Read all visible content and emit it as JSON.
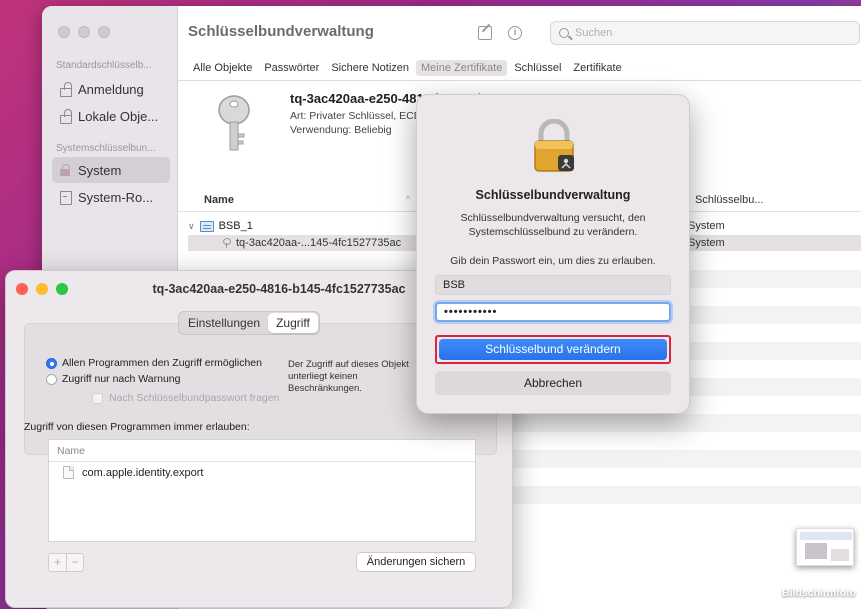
{
  "keychain": {
    "window_title": "Schlüsselbundverwaltung",
    "search_placeholder": "Suchen",
    "sidebar": {
      "section_default": "Standardschlüsselb...",
      "default_items": [
        "Anmeldung",
        "Lokale Obje..."
      ],
      "section_system": "Systemschlüsselbun...",
      "system_items": [
        "System",
        "System-Ro..."
      ],
      "selected": "System"
    },
    "tabs": [
      "Alle Objekte",
      "Passwörter",
      "Sichere Notizen",
      "Meine Zertifikate",
      "Schlüssel",
      "Zertifikate"
    ],
    "active_tab": "Meine Zertifikate",
    "detail": {
      "title": "tq-3ac420aa-e250-4816-b145-4fc1527735ac",
      "kind": "Art: Privater Schlüssel, ECDSA",
      "usage": "Verwendung: Beliebig"
    },
    "list": {
      "col_name": "Name",
      "col_keychain": "Schlüsselbu...",
      "group_name": "BSB_1",
      "child_name": "tq-3ac420aa-...145-4fc1527735ac",
      "group_keychain": "System",
      "child_keychain": "System"
    }
  },
  "access_dialog": {
    "title": "tq-3ac420aa-e250-4816-b145-4fc1527735ac",
    "segments": [
      "Einstellungen",
      "Zugriff"
    ],
    "active_segment": "Zugriff",
    "radio_all": "Allen Programmen den Zugriff ermöglichen",
    "radio_warn": "Zugriff nur nach Warnung",
    "checkbox_password": "Nach Schlüsselbundpasswort fragen",
    "description": "Der Zugriff auf dieses Objekt unterliegt keinen Beschränkungen.",
    "always_allow_label": "Zugriff von diesen Programmen immer erlauben:",
    "programs_header": "Name",
    "programs": [
      "com.apple.identity.export"
    ],
    "add_label": "+",
    "remove_label": "−",
    "save_label": "Änderungen sichern"
  },
  "auth_sheet": {
    "title": "Schlüsselbundverwaltung",
    "message": "Schlüsselbundverwaltung versucht, den Systemschlüsselbund zu verändern.",
    "hint": "Gib dein Passwort ein, um dies zu erlauben.",
    "username": "BSB",
    "password_masked": "•••••••••••",
    "primary_label": "Schlüsselbund verändern",
    "secondary_label": "Abbrechen"
  },
  "desktop": {
    "screenshot_label": "Bildschirmfoto"
  },
  "colors": {
    "accent": "#3478f6",
    "highlight": "#d9243a"
  }
}
